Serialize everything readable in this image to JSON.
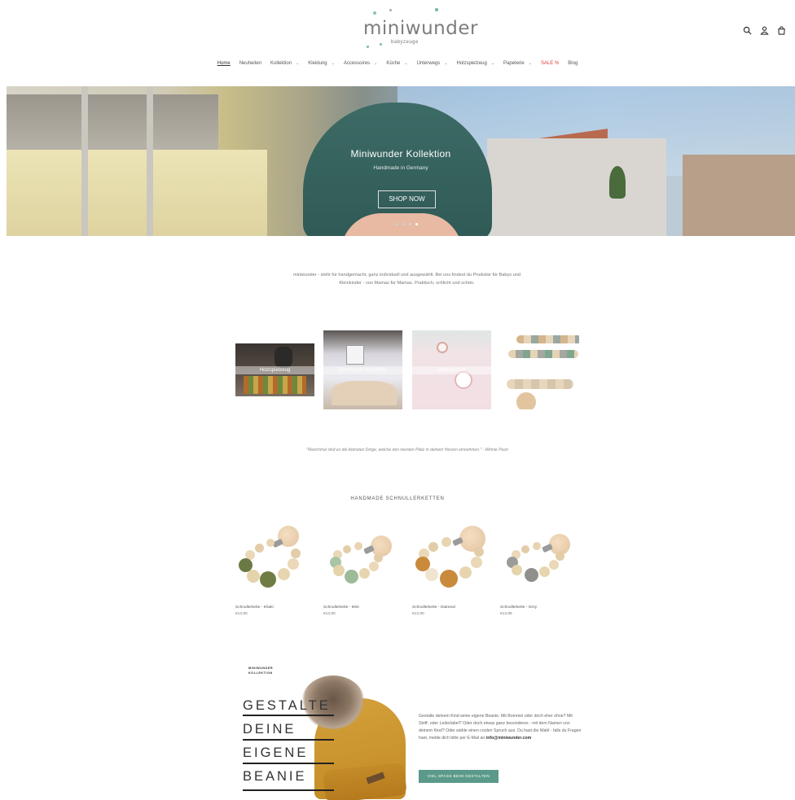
{
  "header": {
    "logo_text": "miniwunder",
    "logo_sub": "babyzeuge",
    "icons": [
      "search-icon",
      "user-icon",
      "cart-icon"
    ]
  },
  "nav": {
    "items": [
      {
        "label": "Home",
        "active": true,
        "dropdown": false
      },
      {
        "label": "Neuheiten",
        "dropdown": false
      },
      {
        "label": "Kollektion",
        "dropdown": true
      },
      {
        "label": "Kleidung",
        "dropdown": true
      },
      {
        "label": "Accessoires",
        "dropdown": true
      },
      {
        "label": "Küche",
        "dropdown": true
      },
      {
        "label": "Unterwegs",
        "dropdown": true
      },
      {
        "label": "Holzspielzeug",
        "dropdown": true
      },
      {
        "label": "Papeterie",
        "dropdown": true
      },
      {
        "label": "SALE %",
        "dropdown": false,
        "sale": true
      },
      {
        "label": "Blog",
        "dropdown": false
      }
    ]
  },
  "hero": {
    "title": "Miniwunder Kollektion",
    "subtitle": "Handmade in Germany",
    "button": "SHOP NOW",
    "slides": 4,
    "active_slide": 4
  },
  "intro": {
    "text": "miniwunder - steht für handgemacht, ganz individuell und ausgewählt. Bei uns findest du Produkte für Babys und Kleinkinder - von Mamas für Mamas. Praktisch, schlicht und schön."
  },
  "categories": [
    {
      "label": "Holzspielzeug"
    },
    {
      "label": "Miniwunder Kollektion"
    },
    {
      "label": "Babygeschirr"
    },
    {
      "label": "Schnullerketten"
    }
  ],
  "quote": {
    "text": "\"Manchmal sind es die kleinsten Dinge, welche den meisten Platz in deinem Herzen einnehmen.\" - Winnie Puuh"
  },
  "section": {
    "title": "HANDMADE SCHNULLERKETTEN"
  },
  "products": [
    {
      "name": "Schnullerkette - Khaki",
      "price": "€13,90"
    },
    {
      "name": "Schnullerkette - Mint",
      "price": "€13,90"
    },
    {
      "name": "Schnullerkette - Oatmeal",
      "price": "€13,90"
    },
    {
      "name": "Schnullerkette - Grey",
      "price": "€13,99"
    }
  ],
  "promo": {
    "brand_line1": "MINIWUNDER",
    "brand_line2": "KOLLEKTION",
    "headline": [
      "GESTALTE",
      "DEINE",
      "EIGENE",
      "BEANIE"
    ],
    "text": "Gestalte deinem Kind seine eigene Beanie. Mit Bommel oder doch eher ohne? Mit Stoff- oder Lederlabel? Oder doch etwas ganz besonderes - mit dem Namen von deinem Kind? Oder wähle einen coolen Spruch aus. Du hast die Wahl - falls du Fragen hast, melde dich bitte per E-Mail an",
    "email": "info@miniwunder.com",
    "button": "VIEL SPASS BEIM GESTALTEN"
  },
  "colors": {
    "accent": "#5b9a8a",
    "sale": "#e23a3a"
  }
}
